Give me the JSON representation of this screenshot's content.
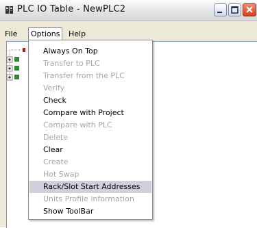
{
  "window": {
    "title": "PLC IO Table - NewPLC2"
  },
  "menubar": {
    "file": "File",
    "options": "Options",
    "help": "Help"
  },
  "options_menu": {
    "items": [
      {
        "label": "Always On Top",
        "enabled": true
      },
      {
        "label": "Transfer to PLC",
        "enabled": false
      },
      {
        "label": "Transfer from the PLC",
        "enabled": false
      },
      {
        "label": "Verify",
        "enabled": false
      },
      {
        "label": "Check",
        "enabled": true
      },
      {
        "label": "Compare with Project",
        "enabled": true
      },
      {
        "label": "Compare with PLC",
        "enabled": false
      },
      {
        "label": "Delete",
        "enabled": false
      },
      {
        "label": "Clear",
        "enabled": true
      },
      {
        "label": "Create",
        "enabled": false
      },
      {
        "label": "Hot Swap",
        "enabled": false
      },
      {
        "label": "Rack/Slot Start Addresses",
        "enabled": true,
        "highlighted": true
      },
      {
        "label": "Units Profile information",
        "enabled": false
      },
      {
        "label": "Show ToolBar",
        "enabled": true
      }
    ]
  },
  "colors": {
    "highlight": "#cfd0dc",
    "disabled_text": "#a6a6a6",
    "close_button": "#d4401f"
  }
}
